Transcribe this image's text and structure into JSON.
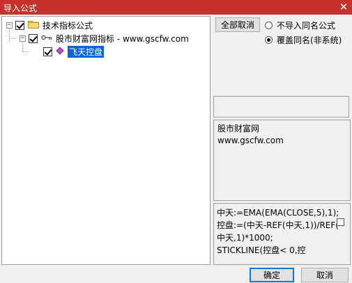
{
  "window": {
    "title": "导入公式",
    "close_glyph": "✕"
  },
  "tree": {
    "root": {
      "label": "技术指标公式",
      "checked": true,
      "expander": "−"
    },
    "child": {
      "label": "股市财富网指标 - www.gscfw.com",
      "checked": true,
      "expander": "−"
    },
    "leaf": {
      "label": "飞天控盘",
      "checked": true,
      "selected": true
    }
  },
  "options": {
    "cancel_all_label": "全部取消",
    "radio_no_import_same_name": {
      "label": "不导入同名公式",
      "selected": false
    },
    "radio_overwrite_same_name": {
      "label": "覆盖同名(非系统)",
      "selected": true
    }
  },
  "description": {
    "line1": "股市财富网",
    "line2": "www.gscfw.com"
  },
  "code": {
    "lines": [
      "中天:=EMA(EMA(CLOSE,5),1);",
      "控盘:=(中天-REF(中天,1))/REF(",
      "中天,1)*1000;",
      "STICKLINE(控盘< 0,控"
    ]
  },
  "footer": {
    "ok_label": "确定",
    "cancel_label": "取消"
  },
  "colors": {
    "titlebar": "#c7312c",
    "selection": "#0a64d8",
    "folder": "#f2c94c"
  },
  "icons": [
    "folder-icon",
    "key-icon",
    "formula-diamond-icon",
    "close-icon"
  ]
}
